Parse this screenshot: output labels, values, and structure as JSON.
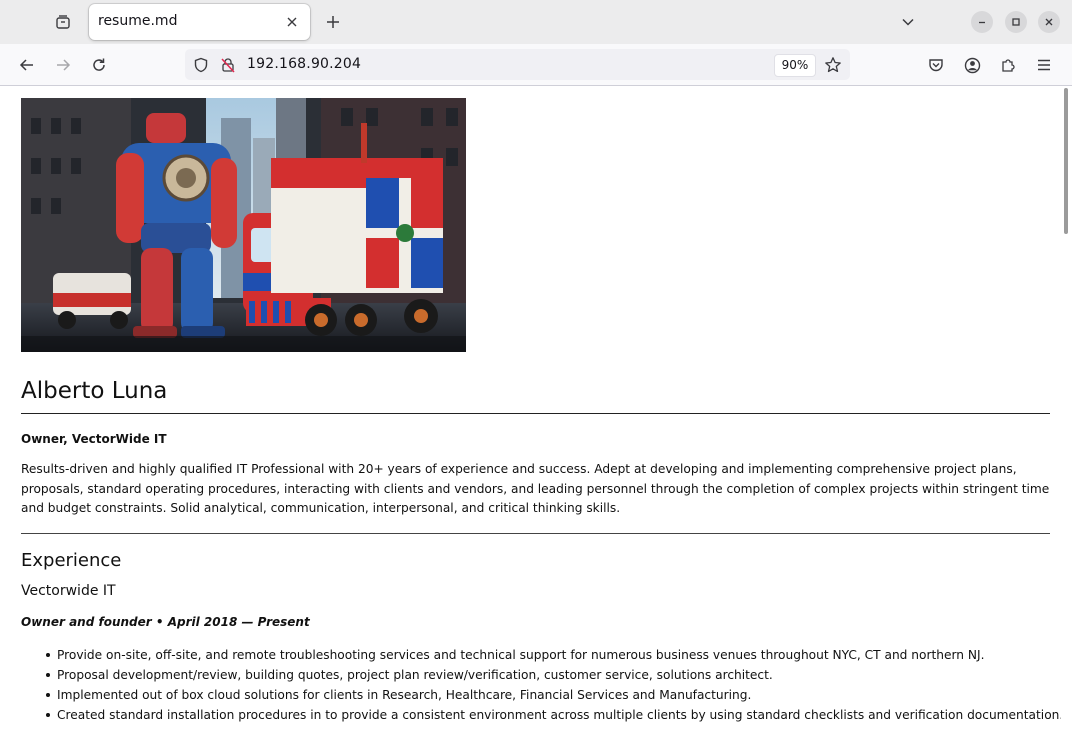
{
  "browser": {
    "tab_title": "resume.md",
    "url": "192.168.90.204",
    "zoom": "90%"
  },
  "icons": {
    "tab_list": "tab-list-icon",
    "tab_close": "close-icon",
    "new_tab": "plus-icon",
    "tabs_overflow": "chevron-down-icon",
    "minimize": "minimize-icon",
    "maximize": "maximize-icon",
    "close_window": "close-icon",
    "back": "arrow-left-icon",
    "forward": "arrow-right-icon",
    "reload": "reload-icon",
    "tracking_protection": "shield-icon",
    "insecure": "lock-slash-icon",
    "bookmark": "star-icon",
    "pocket": "pocket-icon",
    "account": "account-icon",
    "extensions": "puzzle-icon",
    "menu": "hamburger-menu-icon"
  },
  "resume": {
    "name": "Alberto Luna",
    "role": "Owner, VectorWide IT",
    "summary": "Results-driven and highly qualified IT Professional with 20+ years of experience and success. Adept at developing and implementing comprehensive project plans, proposals, standard operating procedures, interacting with clients and vendors, and leading personnel through the completion of complex projects within stringent time and budget constraints. Solid analytical, communication, interpersonal, and critical thinking skills.",
    "experience_heading": "Experience",
    "company": "Vectorwide IT",
    "job_title": "Owner and founder • April 2018 — Present",
    "bullets": [
      "Provide on-site, off-site, and remote troubleshooting services and technical support for numerous business venues throughout NYC, CT and northern NJ.",
      "Proposal development/review, building quotes, project plan review/verification, customer service, solutions architect.",
      "Implemented out of box cloud solutions for clients in Research, Healthcare, Financial Services and Manufacturing.",
      "Created standard installation procedures in to provide a consistent environment across multiple clients by using standard checklists and verification documentation."
    ]
  },
  "colors": {
    "tabbar_bg": "#ececed",
    "navbar_bg": "#f9f9fb",
    "urlbar_bg": "#f0f0f4",
    "flag_blue": "#1f4fb0",
    "flag_red": "#d42a2a"
  }
}
